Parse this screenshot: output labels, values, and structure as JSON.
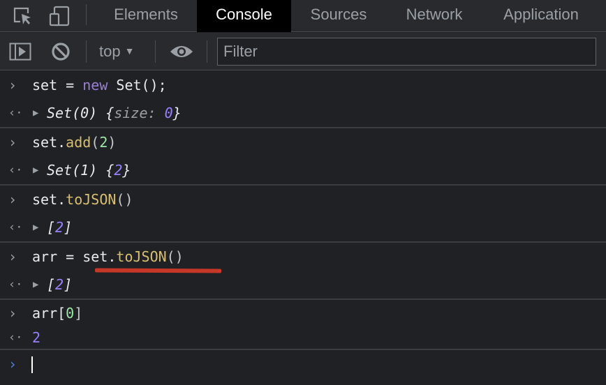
{
  "tabs": [
    {
      "label": "Elements",
      "active": false
    },
    {
      "label": "Console",
      "active": true
    },
    {
      "label": "Sources",
      "active": false
    },
    {
      "label": "Network",
      "active": false
    },
    {
      "label": "Application",
      "active": false
    }
  ],
  "toolbar": {
    "context": "top",
    "filter_placeholder": "Filter",
    "icons": [
      "sidebar-toggle-icon",
      "clear-console-icon",
      "live-expression-eye-icon"
    ]
  },
  "colors": {
    "background": "#202124",
    "toolbar": "#292a2d",
    "keyword": "#9a7fd5",
    "function": "#d8c070",
    "number_input": "#9ce6a8",
    "number_output": "#9980ff",
    "annotation": "#c53727",
    "prompt_active": "#4e83d4"
  },
  "entries": [
    {
      "input": {
        "p1": "set = ",
        "kw": "new",
        "p2": " Set();"
      },
      "output": {
        "a": "Set(0) {",
        "prop": "size: ",
        "val": "0",
        "b": "}"
      }
    },
    {
      "input": {
        "p1": "set.",
        "fn": "add",
        "p2": "(",
        "num": "2",
        "p3": ")"
      },
      "output": {
        "a": "Set(1) {",
        "val": "2",
        "b": "}"
      }
    },
    {
      "input": {
        "p1": "set.",
        "fn": "toJSON",
        "p2": "()"
      },
      "output": {
        "a": "[",
        "val": "2",
        "b": "]"
      }
    },
    {
      "input": {
        "p1": "arr = set.",
        "fn": "toJSON",
        "p2": "()"
      },
      "output": {
        "a": "[",
        "val": "2",
        "b": "]"
      }
    },
    {
      "input": {
        "p1": "arr[",
        "num": "0",
        "p2": "]"
      },
      "output": {
        "val": "2"
      }
    }
  ],
  "symbols": {
    "prompt": "›",
    "return": "‹·",
    "expand": "▶"
  }
}
